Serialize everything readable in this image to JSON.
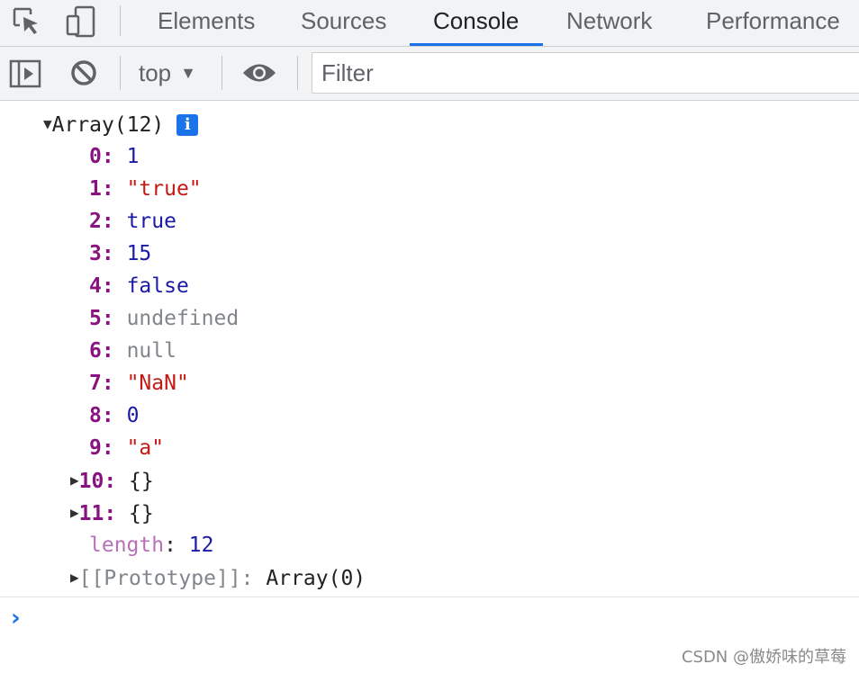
{
  "tabs": {
    "elements": "Elements",
    "sources": "Sources",
    "console": "Console",
    "network": "Network",
    "performance": "Performance"
  },
  "toolbar": {
    "context": "top",
    "filter_placeholder": "Filter"
  },
  "output": {
    "header": "Array(12)",
    "info_badge": "i",
    "items": [
      {
        "key": "0",
        "value": "1"
      },
      {
        "key": "1",
        "value": "\"true\""
      },
      {
        "key": "2",
        "value": "true"
      },
      {
        "key": "3",
        "value": "15"
      },
      {
        "key": "4",
        "value": "false"
      },
      {
        "key": "5",
        "value": "undefined"
      },
      {
        "key": "6",
        "value": "null"
      },
      {
        "key": "7",
        "value": "\"NaN\""
      },
      {
        "key": "8",
        "value": "0"
      },
      {
        "key": "9",
        "value": "\"a\""
      },
      {
        "key": "10",
        "value": "{}"
      },
      {
        "key": "11",
        "value": "{}"
      }
    ],
    "length_key": "length",
    "length_value": "12",
    "prototype_key": "[[Prototype]]",
    "prototype_value": "Array(0)"
  },
  "icons": {
    "inspect": "inspect-element-icon",
    "device": "device-toolbar-icon",
    "sidebar": "show-sidebar-icon",
    "clear": "clear-console-icon",
    "eye": "live-expression-icon",
    "prompt": "console-prompt-icon"
  },
  "colors": {
    "accent": "#1a73e8",
    "key": "#881280",
    "number": "#1a1aa6",
    "string": "#c41a16",
    "muted": "#80868b"
  },
  "watermark": "CSDN @傲娇味的草莓"
}
